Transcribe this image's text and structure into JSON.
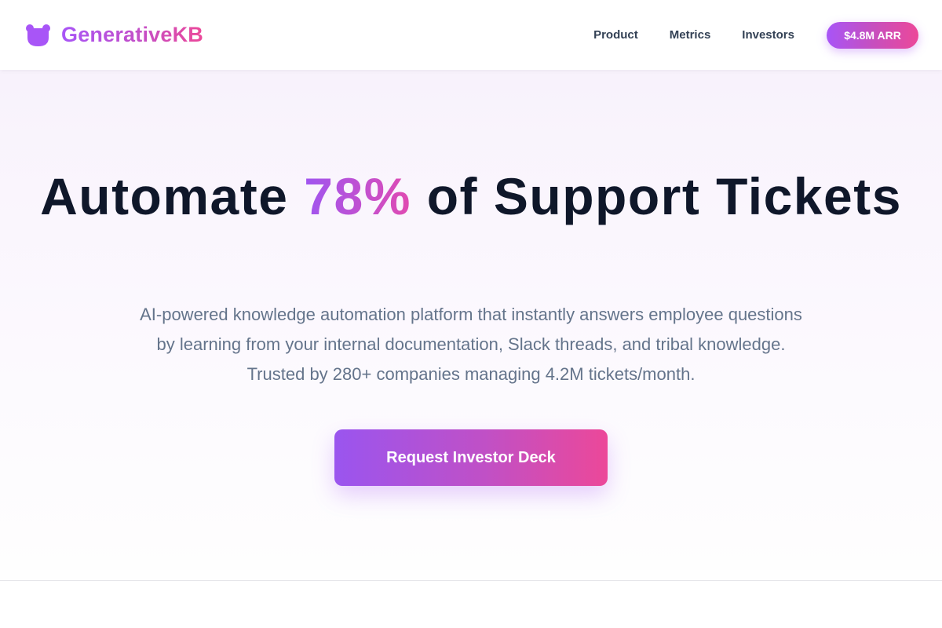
{
  "brand": {
    "name": "GenerativeKB",
    "icon": "bear-icon",
    "accent_colors": [
      "#a855f7",
      "#ec4899"
    ]
  },
  "nav": {
    "items": [
      {
        "label": "Product"
      },
      {
        "label": "Metrics"
      },
      {
        "label": "Investors"
      }
    ],
    "badge_label": "$4.8M ARR"
  },
  "hero": {
    "title_before": "Automate ",
    "title_highlight": "78%",
    "title_after": " of Support Tickets",
    "subtitle": "AI-powered knowledge automation platform that instantly answers employee questions by learning from your internal documentation, Slack threads, and tribal knowledge. Trusted by 280+ companies managing 4.2M tickets/month.",
    "cta_label": "Request Investor Deck"
  }
}
